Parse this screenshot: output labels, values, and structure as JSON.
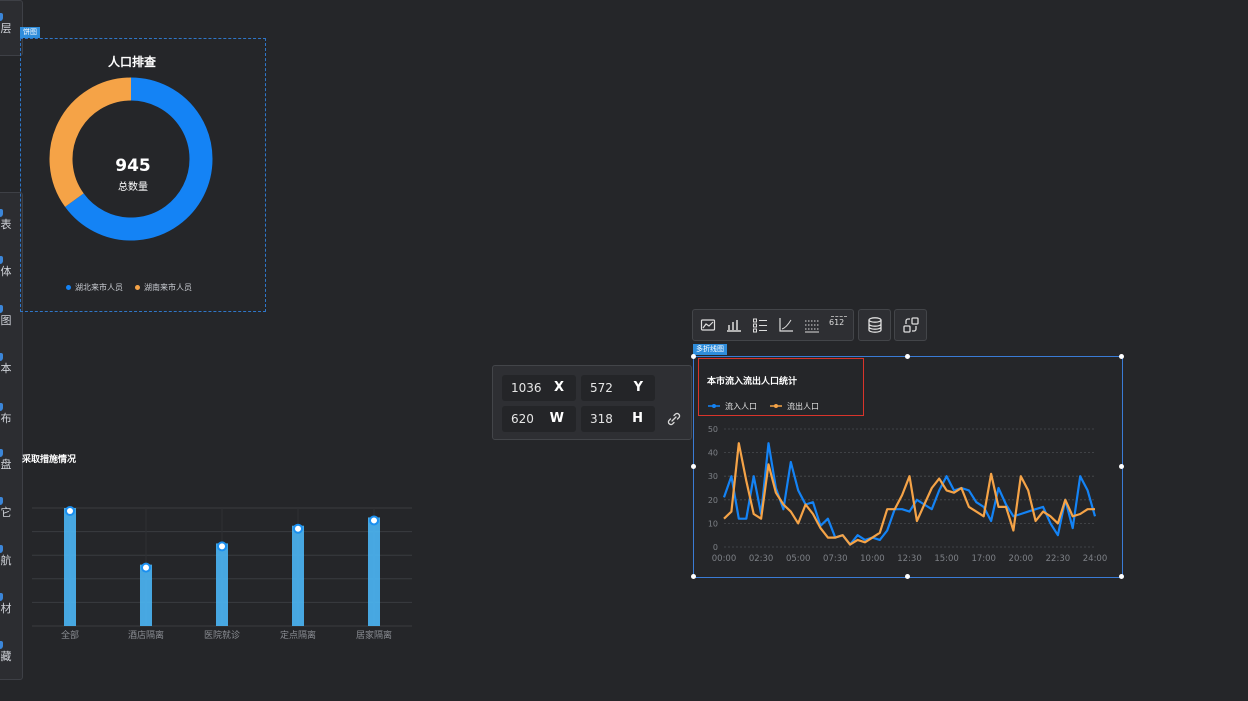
{
  "left_toolbar_top": {
    "label": "层"
  },
  "left_toolbar": {
    "items": [
      {
        "label": "表"
      },
      {
        "label": "体"
      },
      {
        "label": "图"
      },
      {
        "label": "本"
      },
      {
        "label": "布"
      },
      {
        "label": "盘"
      },
      {
        "label": "它"
      },
      {
        "label": "航"
      },
      {
        "label": "材"
      },
      {
        "label": "藏"
      }
    ]
  },
  "donut_card": {
    "tag": "饼图",
    "title": "人口排查",
    "total_value": "945",
    "total_label": "总数量",
    "legend": [
      {
        "label": "湖北来市人员",
        "color": "#1483f5"
      },
      {
        "label": "湖南来市人员",
        "color": "#f5a347"
      }
    ]
  },
  "bar_card": {
    "title": "采取措施情况"
  },
  "coordinates_panel": {
    "x_value": "1036",
    "x_label": "X",
    "y_value": "572",
    "y_label": "Y",
    "w_value": "620",
    "w_label": "W",
    "h_value": "318",
    "h_label": "H",
    "link_icon": "link-icon"
  },
  "chart_toolbar": {
    "icons": [
      "chart-area-icon",
      "bar-chart-icon",
      "list-icon",
      "axis-icon",
      "grid-icon",
      "number-icon",
      "database-icon",
      "swap-icon"
    ],
    "number_label": "612"
  },
  "selected_chart": {
    "tag": "多折线图",
    "title": "本市流入流出人口统计"
  },
  "chart_data": [
    {
      "type": "pie",
      "title": "人口排查",
      "categories": [
        "湖北来市人员",
        "湖南来市人员"
      ],
      "values": [
        65,
        35
      ],
      "colors": [
        "#1483f5",
        "#f5a347"
      ],
      "center_text": "945",
      "center_subtext": "总数量"
    },
    {
      "type": "bar",
      "title": "采取措施情况",
      "categories": [
        "全部",
        "酒店隔离",
        "医院就诊",
        "定点隔离",
        "居家隔离"
      ],
      "values": [
        100,
        52,
        70,
        85,
        92
      ],
      "ylim": [
        0,
        100
      ],
      "grid": true
    },
    {
      "type": "line",
      "title": "本市流入流出人口统计",
      "x_ticks": [
        "00:00",
        "02:30",
        "05:00",
        "07:30",
        "10:00",
        "12:30",
        "15:00",
        "17:00",
        "20:00",
        "22:30",
        "24:00"
      ],
      "y_ticks": [
        "0",
        "10",
        "20",
        "30",
        "40",
        "50"
      ],
      "ylim": [
        0,
        50
      ],
      "grid": true,
      "legend_position": "top-left",
      "series": [
        {
          "name": "流入人口",
          "color": "#1483f5",
          "values": [
            21,
            30,
            12,
            12,
            30,
            14,
            44,
            25,
            16,
            36,
            24,
            18,
            19,
            9,
            12,
            4,
            5,
            1,
            5,
            3,
            4,
            3,
            7,
            16,
            16,
            15,
            20,
            18,
            16,
            24,
            30,
            24,
            25,
            24,
            19,
            17,
            11,
            25,
            18,
            13,
            14,
            15,
            16,
            17,
            10,
            5,
            20,
            8,
            30,
            24,
            13
          ]
        },
        {
          "name": "流出人口",
          "color": "#f5a347",
          "values": [
            12,
            15,
            44,
            28,
            14,
            12,
            35,
            23,
            18,
            15,
            10,
            18,
            14,
            8,
            4,
            4,
            5,
            1,
            3,
            2,
            4,
            6,
            16,
            16,
            22,
            30,
            11,
            18,
            25,
            29,
            24,
            23,
            25,
            17,
            15,
            13,
            31,
            17,
            17,
            7,
            30,
            24,
            11,
            15,
            13,
            10,
            20,
            13,
            14,
            16,
            16
          ]
        }
      ]
    }
  ]
}
